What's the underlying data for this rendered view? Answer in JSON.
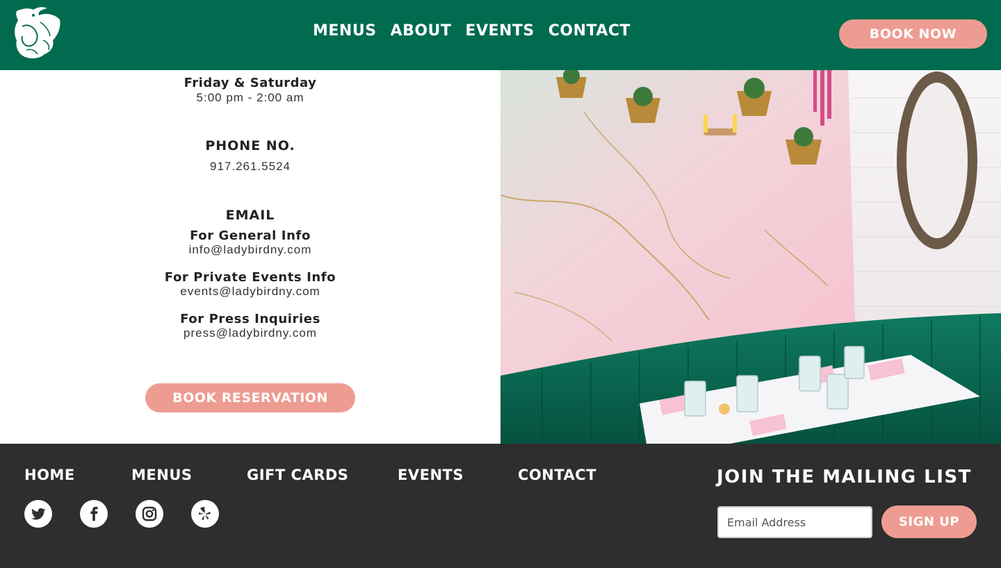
{
  "header": {
    "logo_icon": "bird-floral-logo-icon",
    "nav": [
      "MENUS",
      "ABOUT",
      "EVENTS",
      "CONTACT"
    ],
    "book_now_label": "BOOK NOW"
  },
  "info": {
    "hours_day": "Friday & Saturday",
    "hours_time": "5:00 pm - 2:00 am",
    "phone_heading": "PHONE NO.",
    "phone_value": "917.261.5524",
    "email_heading": "EMAIL",
    "general_label": "For General Info",
    "general_email": "info@ladybirdny.com",
    "events_label": "For Private Events Info",
    "events_email": "events@ladybirdny.com",
    "press_label": "For Press Inquiries",
    "press_email": "press@ladybirdny.com",
    "book_reservation_label": "BOOK RESERVATION"
  },
  "footer": {
    "links": [
      "HOME",
      "MENUS",
      "GIFT CARDS",
      "EVENTS",
      "CONTACT"
    ],
    "social_icons": [
      "twitter-icon",
      "facebook-icon",
      "instagram-icon",
      "yelp-icon"
    ],
    "mailing_title": "JOIN THE MAILING LIST",
    "email_placeholder": "Email Address",
    "sign_up_label": "SIGN UP"
  },
  "colors": {
    "brand_green": "#006b4f",
    "accent_pink": "#ee9c91",
    "footer_bg": "#2e2e2e",
    "banquette_green": "#0b6b55"
  }
}
